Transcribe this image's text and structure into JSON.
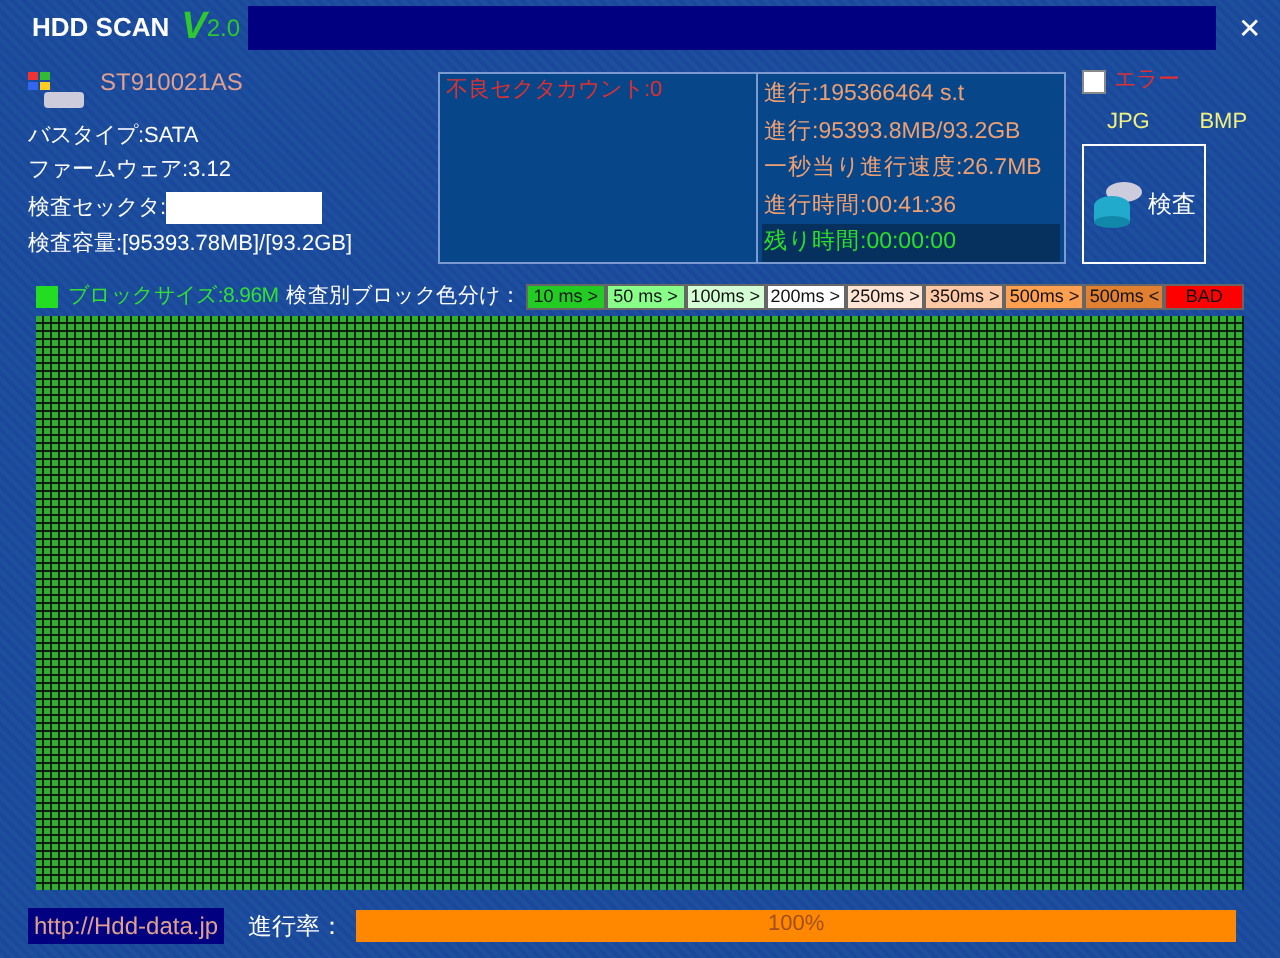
{
  "window": {
    "title": "HDD SCAN",
    "version_letter": "V",
    "version_number": "2.0",
    "close": "✕"
  },
  "drive": {
    "model": "ST910021AS",
    "info": [
      "バスタイプ:SATA",
      "ファームウェア:3.12"
    ],
    "sector_label": "検査セックタ:",
    "capacity": "検査容量:[95393.78MB]/[93.2GB]"
  },
  "bad_sectors": "不良セクタカウント:0",
  "stats": [
    {
      "text": "進行:195366464 s.t",
      "kind": "normal"
    },
    {
      "text": "進行:95393.8MB/93.2GB",
      "kind": "normal"
    },
    {
      "text": "一秒当り進行速度:26.7MB",
      "kind": "normal"
    },
    {
      "text": "進行時間:00:41:36",
      "kind": "normal"
    },
    {
      "text": "残り時間:00:00:00",
      "kind": "remaining"
    }
  ],
  "error_checkbox": {
    "label": "エラー",
    "checked": false
  },
  "export": [
    "JPG",
    "BMP"
  ],
  "scan_button": "検査",
  "block_size": "ブロックサイズ:8.96M",
  "legend_title": "検査別ブロック色分け：",
  "legend": [
    {
      "label": "10 ms >",
      "color": "#22cc22"
    },
    {
      "label": "50 ms >",
      "color": "#88ff88"
    },
    {
      "label": "100ms >",
      "color": "#d4ffd4"
    },
    {
      "label": "200ms >",
      "color": "#ffffff"
    },
    {
      "label": "250ms >",
      "color": "#ffe4d4"
    },
    {
      "label": "350ms >",
      "color": "#ffc8a4"
    },
    {
      "label": "500ms >",
      "color": "#ff9f50"
    },
    {
      "label": "500ms <",
      "color": "#e08030"
    },
    {
      "label": "BAD",
      "color": "#ff0000"
    }
  ],
  "footer": {
    "url": "http://Hdd-data.jp",
    "progress_label": "進行率：",
    "progress": {
      "level": 1,
      "text": "100%"
    }
  }
}
